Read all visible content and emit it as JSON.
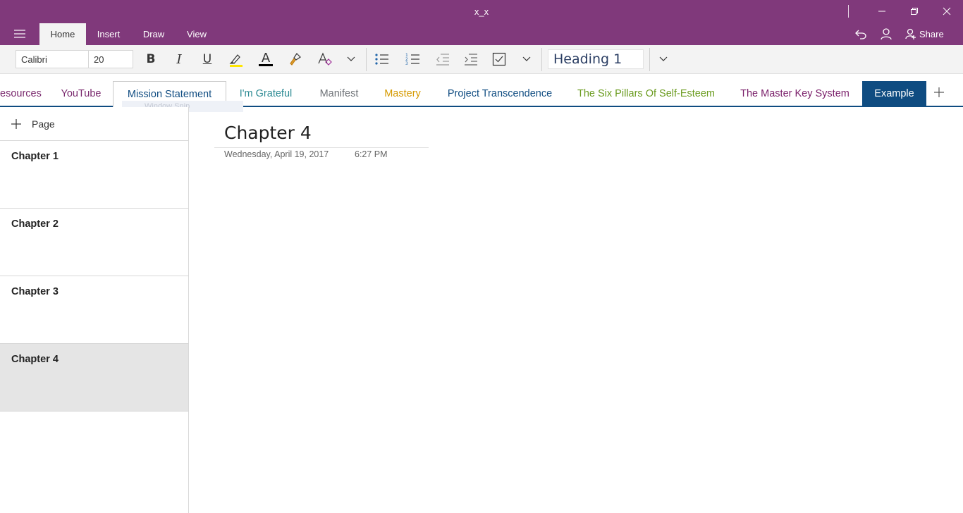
{
  "window": {
    "title": "x_x"
  },
  "ribbon": {
    "tabs": [
      "Home",
      "Insert",
      "Draw",
      "View"
    ],
    "share_label": "Share"
  },
  "toolbar": {
    "font_name": "Calibri",
    "font_size": "20",
    "style": "Heading 1",
    "bold_glyph": "B",
    "italic_glyph": "I",
    "underline_glyph": "U",
    "font_color_glyph": "A"
  },
  "sections": [
    {
      "label": "esources",
      "color": "#7a2a6e"
    },
    {
      "label": "YouTube",
      "color": "#7a2a6e"
    },
    {
      "label": "Mission Statement",
      "color": "#0f4c81"
    },
    {
      "label": "I'm Grateful",
      "color": "#2e8b94"
    },
    {
      "label": "Manifest",
      "color": "#6f7378"
    },
    {
      "label": "Mastery",
      "color": "#d59a00"
    },
    {
      "label": "Project Transcendence",
      "color": "#0f4c81"
    },
    {
      "label": "The Six Pillars Of Self-Esteem",
      "color": "#6a9b1e"
    },
    {
      "label": "The Master Key System",
      "color": "#7a1f6a"
    },
    {
      "label": "Example",
      "color": "#ffffff"
    }
  ],
  "drag_ghost": "Window Snip",
  "pages": {
    "add_label": "Page",
    "items": [
      "Chapter 1",
      "Chapter 2",
      "Chapter 3",
      "Chapter 4"
    ],
    "selected": "Chapter 4"
  },
  "page": {
    "title": "Chapter 4",
    "date": "Wednesday, April 19, 2017",
    "time": "6:27 PM"
  },
  "colors": {
    "titlebar": "#80397b",
    "accent": "#0f4c81",
    "highlight": "#ffe600"
  }
}
